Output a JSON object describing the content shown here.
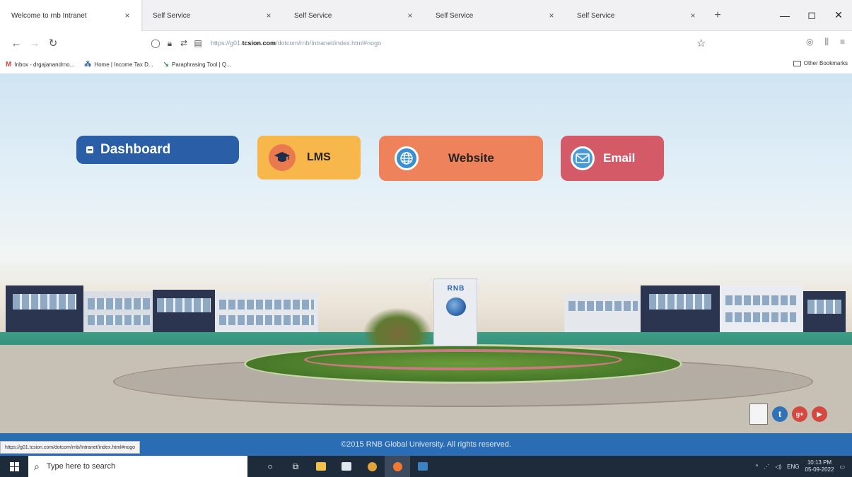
{
  "browser": {
    "tabs": [
      {
        "title": "Welcome to rnb Intranet",
        "active": true
      },
      {
        "title": "Self Service",
        "active": false
      },
      {
        "title": "Self Service",
        "active": false
      },
      {
        "title": "Self Service",
        "active": false
      },
      {
        "title": "Self Service",
        "active": false
      }
    ],
    "tab_close_glyph": "×",
    "new_tab_glyph": "+",
    "url_prefix": "https://g01.",
    "url_host": "tcsion.com",
    "url_path": "/dotcom/rnb/Intranet/index.html#nogo",
    "bookmarks": [
      {
        "icon": "gmail-icon",
        "glyph": "M",
        "label": "Inbox - drgajanandrno..."
      },
      {
        "icon": "income-tax-icon",
        "glyph": "⁂",
        "label": "Home | Income Tax D..."
      },
      {
        "icon": "paraphrasing-tool-icon",
        "glyph": "↘",
        "label": "Paraphrasing Tool | Q..."
      }
    ],
    "other_bookmarks": "Other Bookmarks"
  },
  "page": {
    "menu": {
      "dashboard": "Dashboard",
      "lms": "LMS",
      "website": "Website",
      "email": "Email"
    },
    "pillar_logo": "RNB",
    "footer_text": "©2015 RNB Global University. All rights reserved.",
    "status_url": "https://g01.tcsion.com/dotcom/rnb/Intranet/index.html#nogo",
    "social": [
      {
        "icon": "tumblr-icon",
        "glyph": "t"
      },
      {
        "icon": "google-plus-icon",
        "glyph": "g+"
      },
      {
        "icon": "youtube-icon",
        "glyph": "▶"
      }
    ]
  },
  "taskbar": {
    "search_placeholder": "Type here to search",
    "language": "ENG",
    "time": "10:13 PM",
    "date": "05-09-2022"
  },
  "colors": {
    "dashboard": "#2a5fa8",
    "lms": "#f7b74a",
    "website": "#ee825a",
    "email": "#d35a66",
    "footer": "#2b6db4",
    "taskbar": "#1e2b3b"
  }
}
